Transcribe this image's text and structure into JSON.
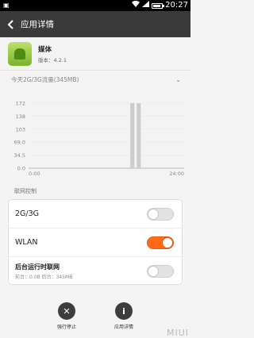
{
  "status_bar": {
    "time": "20:27"
  },
  "header": {
    "title": "应用详情"
  },
  "app": {
    "name": "媒体",
    "version": "版本：4.2.1"
  },
  "traffic": {
    "label": "今天2G/3G流量(345MB)"
  },
  "chart_data": {
    "type": "bar",
    "x_ticks": [
      "0:00",
      "24:00"
    ],
    "y_ticks": [
      "172",
      "138",
      "103",
      "69.0",
      "34.5",
      "0.0"
    ],
    "ylim": [
      0,
      172
    ],
    "x_range_hours": [
      0,
      24
    ],
    "bars": [
      {
        "hour": 16.0,
        "value": 172
      },
      {
        "hour": 17.0,
        "value": 172
      }
    ],
    "grid": true,
    "bar_color": "#cccccc"
  },
  "network_control": {
    "section_label": "联网控制",
    "rows": [
      {
        "label": "2G/3G",
        "state": "off"
      },
      {
        "label": "WLAN",
        "state": "on"
      },
      {
        "label": "后台运行时联网",
        "sub": "前台：0.0B    后台：345MB",
        "state": "off"
      }
    ]
  },
  "actions": [
    {
      "label": "强行停止",
      "icon": "close-icon"
    },
    {
      "label": "应用详情",
      "icon": "info-icon"
    }
  ],
  "brand_watermark": "MIUI",
  "colors": {
    "accent": "#ff6a1a",
    "titlebar": "#3a3a3a"
  }
}
